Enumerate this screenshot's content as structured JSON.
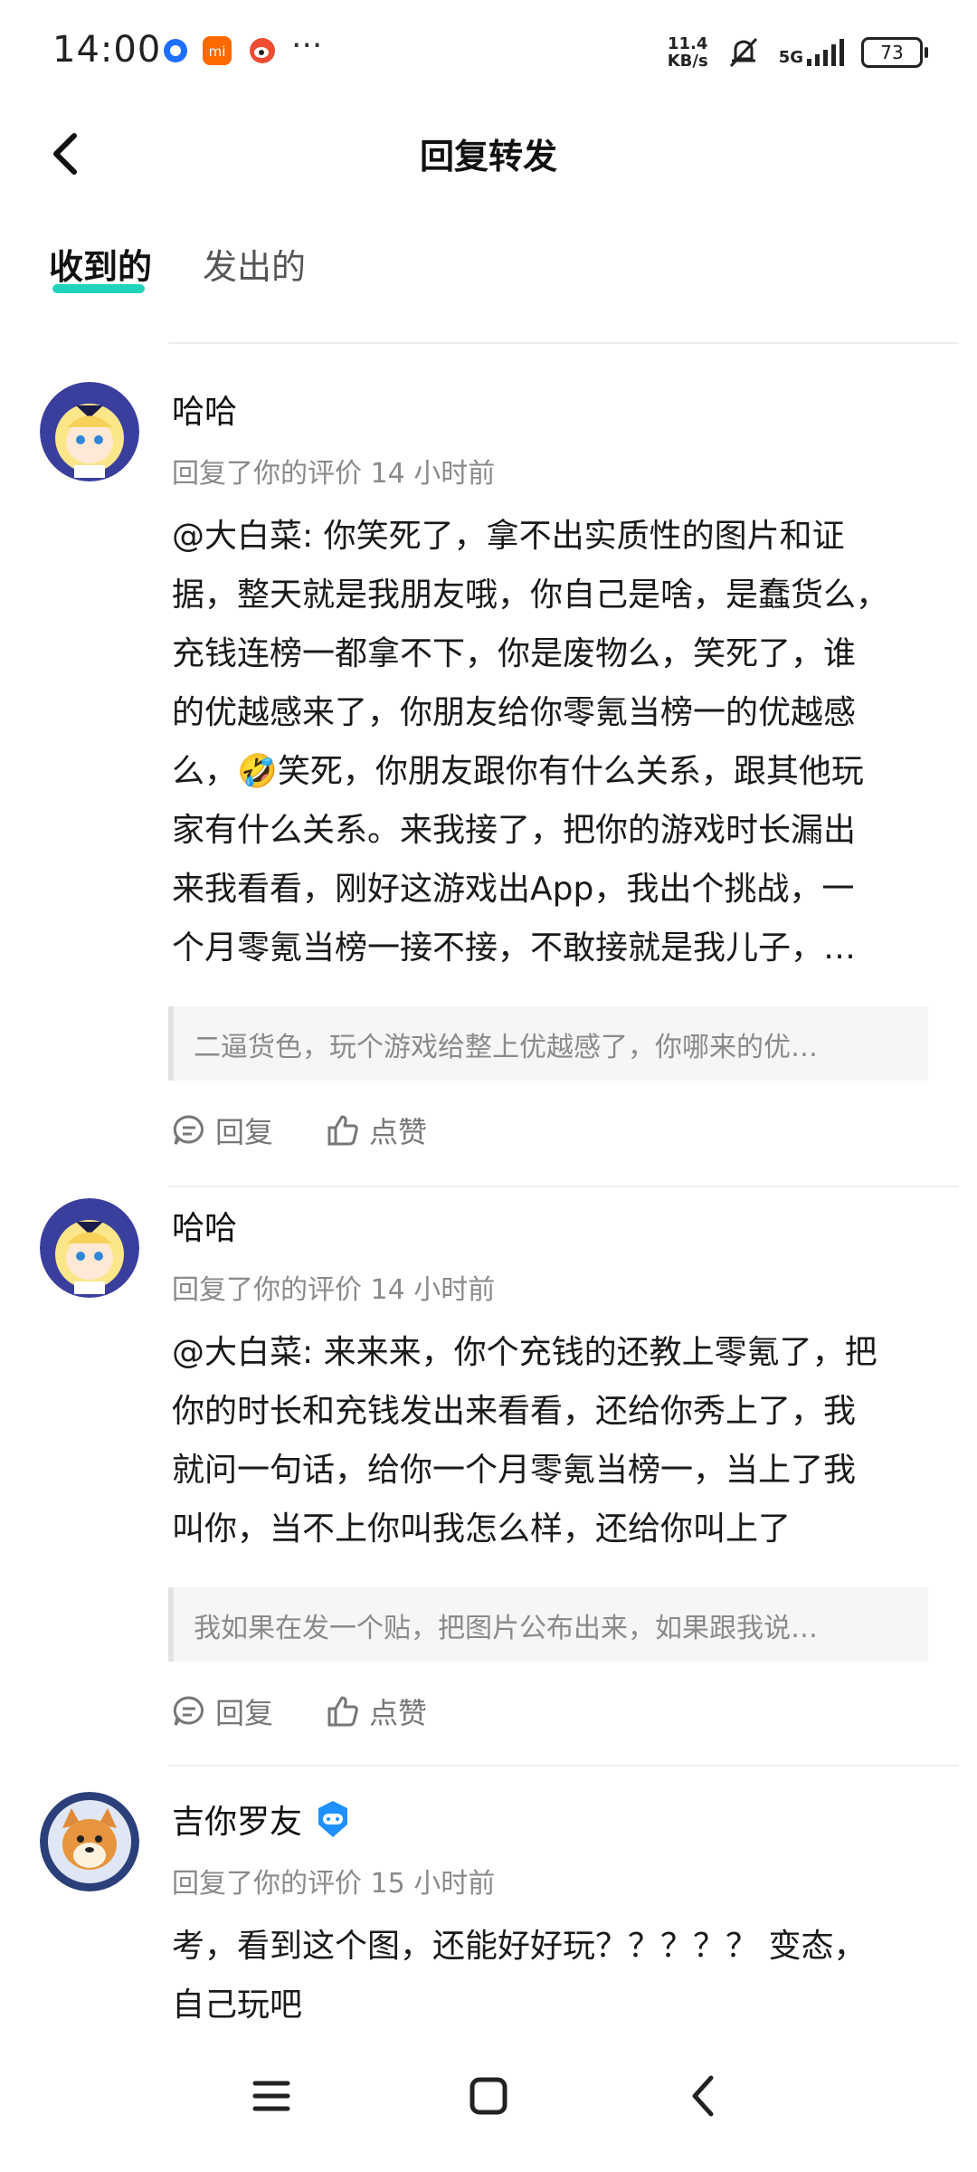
{
  "status": {
    "time": "14:00",
    "speed_value": "11.4",
    "speed_unit": "KB/s",
    "network": "5G",
    "battery": "73"
  },
  "header": {
    "title": "回复转发"
  },
  "tabs": [
    {
      "label": "收到的",
      "active": true
    },
    {
      "label": "发出的",
      "active": false
    }
  ],
  "comments": [
    {
      "username": "哈哈",
      "meta": "回复了你的评价 14 小时前",
      "lines": [
        "@大白菜: 你笑死了，拿不出实质性的图片和证",
        "据，整天就是我朋友哦，你自己是啥，是蠢货么，",
        "充钱连榜一都拿不下，你是废物么，笑死了，谁",
        "的优越感来了，你朋友给你零氪当榜一的优越感",
        "么，🤣笑死，你朋友跟你有什么关系，跟其他玩",
        "家有什么关系。来我接了，把你的游戏时长漏出",
        "来我看看，刚好这游戏出App，我出个挑战，一",
        "个月零氪当榜一接不接，不敢接就是我儿子，…"
      ],
      "quote": "二逼货色，玩个游戏给整上优越感了，你哪来的优…",
      "reply_label": "回复",
      "like_label": "点赞"
    },
    {
      "username": "哈哈",
      "meta": "回复了你的评价 14 小时前",
      "lines": [
        "@大白菜: 来来来，你个充钱的还教上零氪了，把",
        "你的时长和充钱发出来看看，还给你秀上了，我",
        "就问一句话，给你一个月零氪当榜一，当上了我",
        "叫你，当不上你叫我怎么样，还给你叫上了"
      ],
      "quote": "我如果在发一个贴，把图片公布出来，如果跟我说…",
      "reply_label": "回复",
      "like_label": "点赞"
    },
    {
      "username": "吉你罗友",
      "meta": "回复了你的评价 15 小时前",
      "lines": [
        "考，看到这个图，还能好好玩？？？？？ 变态，",
        "自己玩吧"
      ]
    }
  ],
  "colors": {
    "accent": "#21d3bd",
    "verified": "#1e90ff",
    "muted": "#8a8a8a"
  }
}
